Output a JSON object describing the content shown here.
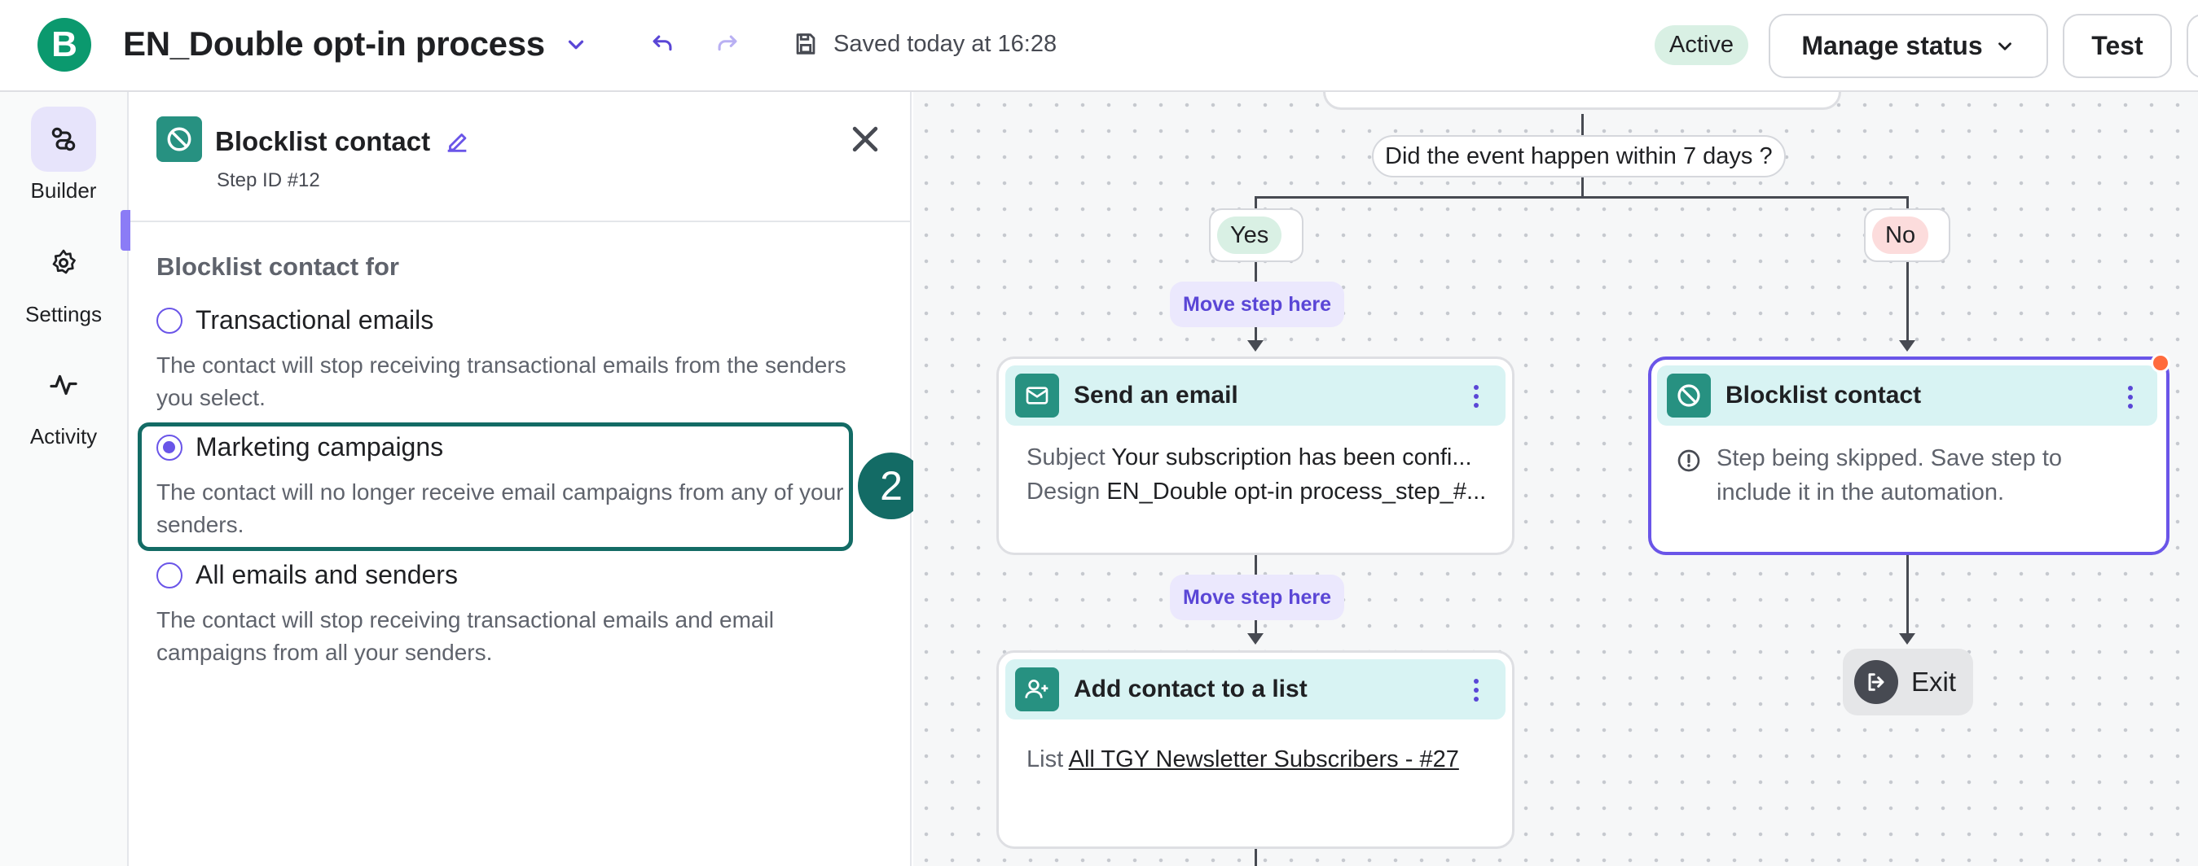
{
  "app": {
    "logo_letter": "B",
    "title": "EN_Double opt-in process",
    "saved_text": "Saved today at 16:28",
    "status_badge": "Active",
    "manage_status_label": "Manage status",
    "test_label": "Test"
  },
  "nav": {
    "items": [
      {
        "label": "Builder",
        "icon": "builder-icon"
      },
      {
        "label": "Settings",
        "icon": "gear-icon"
      },
      {
        "label": "Activity",
        "icon": "activity-icon"
      }
    ]
  },
  "panel": {
    "title": "Blocklist contact",
    "step_id": "Step ID #12",
    "section_label": "Blocklist contact for",
    "options": [
      {
        "label": "Transactional emails",
        "description": "The contact will stop receiving transactional emails from the senders you select.",
        "checked": false
      },
      {
        "label": "Marketing campaigns",
        "description": "The contact will no longer receive email campaigns from any of your senders.",
        "checked": true
      },
      {
        "label": "All emails and senders",
        "description": "The contact will stop receiving transactional emails and email campaigns from all your senders.",
        "checked": false
      }
    ],
    "callout_number": "2"
  },
  "canvas": {
    "condition": "Did the event happen within 7 days ?",
    "yes_label": "Yes",
    "no_label": "No",
    "move_step_label": "Move step here",
    "send_email": {
      "title": "Send an email",
      "subject_label": "Subject",
      "subject_value": "Your subscription has been confi...",
      "design_label": "Design",
      "design_value": "EN_Double opt-in process_step_#..."
    },
    "add_to_list": {
      "title": "Add contact to a list",
      "list_label": "List",
      "list_value": "All TGY Newsletter Subscribers - #27"
    },
    "blocklist": {
      "title": "Blocklist contact",
      "warning": "Step being skipped. Save step to include it in the automation."
    },
    "exit_label": "Exit"
  },
  "colors": {
    "brand": "#0b996e",
    "accent": "#6a55e8",
    "teal": "#279181",
    "highlight": "#136b65"
  }
}
